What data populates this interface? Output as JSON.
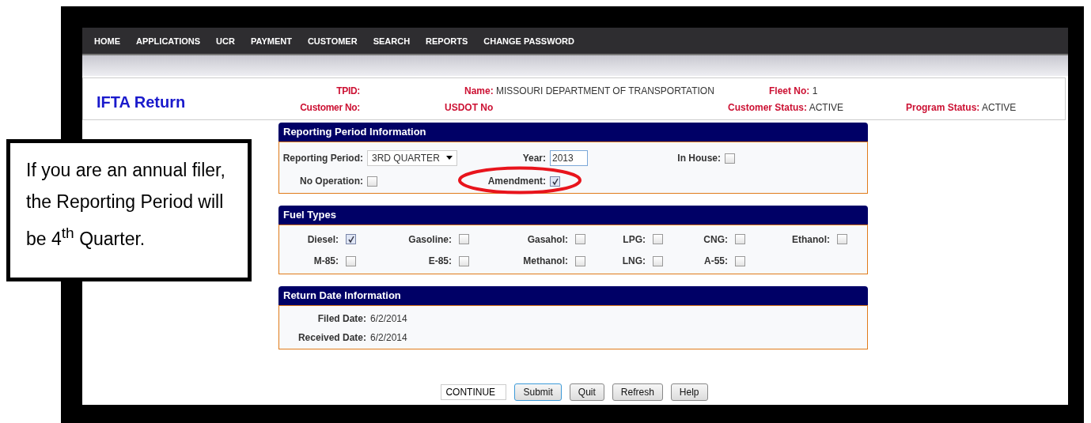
{
  "nav": [
    "HOME",
    "APPLICATIONS",
    "UCR",
    "PAYMENT",
    "CUSTOMER",
    "SEARCH",
    "REPORTS",
    "CHANGE PASSWORD"
  ],
  "header": {
    "title": "IFTA Return",
    "tpid_label": "TPID:",
    "name": {
      "label": "Name:",
      "value": "MISSOURI DEPARTMENT OF TRANSPORTATION"
    },
    "fleet_no": {
      "label": "Fleet No:",
      "value": "1"
    },
    "customer_no_label": "Customer No:",
    "usdot_label": "USDOT No",
    "customer_status": {
      "label": "Customer Status:",
      "value": "ACTIVE"
    },
    "program_status": {
      "label": "Program Status:",
      "value": "ACTIVE"
    }
  },
  "reporting": {
    "title": "Reporting Period Information",
    "period": {
      "label": "Reporting Period:",
      "value": "3RD QUARTER"
    },
    "year": {
      "label": "Year:",
      "value": "2013"
    },
    "in_house": {
      "label": "In House:",
      "checked": false
    },
    "no_operation": {
      "label": "No Operation:",
      "checked": false
    },
    "amendment": {
      "label": "Amendment:",
      "checked": true
    }
  },
  "fuel_types": {
    "title": "Fuel Types",
    "items": [
      {
        "label": "Diesel:",
        "checked": true
      },
      {
        "label": "Gasoline:",
        "checked": false
      },
      {
        "label": "Gasahol:",
        "checked": false
      },
      {
        "label": "LPG:",
        "checked": false
      },
      {
        "label": "CNG:",
        "checked": false
      },
      {
        "label": "Ethanol:",
        "checked": false
      },
      {
        "label": "M-85:",
        "checked": false
      },
      {
        "label": "E-85:",
        "checked": false
      },
      {
        "label": "Methanol:",
        "checked": false
      },
      {
        "label": "LNG:",
        "checked": false
      },
      {
        "label": "A-55:",
        "checked": false
      }
    ]
  },
  "return_dates": {
    "title": "Return Date Information",
    "rows": [
      {
        "label": "Filed Date:",
        "value": "6/2/2014"
      },
      {
        "label": "Received Date:",
        "value": "6/2/2014"
      }
    ]
  },
  "actions": {
    "select": "CONTINUE",
    "buttons": [
      {
        "label": "Submit",
        "focused": true
      },
      {
        "label": "Quit",
        "focused": false
      },
      {
        "label": "Refresh",
        "focused": false
      },
      {
        "label": "Help",
        "focused": false
      }
    ]
  },
  "callout": "If you are an annual filer, the Reporting Period will be 4$^{th}$ Quarter."
}
